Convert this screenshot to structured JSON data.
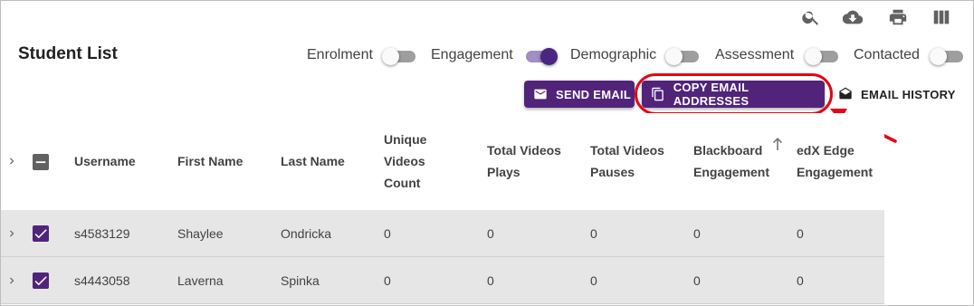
{
  "page": {
    "title": "Student List"
  },
  "toolbar_icons": [
    "search-icon",
    "cloud-download-icon",
    "print-icon",
    "view-column-icon"
  ],
  "toggles": [
    {
      "label": "Enrolment",
      "on": false
    },
    {
      "label": "Engagement",
      "on": true
    },
    {
      "label": "Demographic",
      "on": false
    },
    {
      "label": "Assessment",
      "on": false
    },
    {
      "label": "Contacted",
      "on": false
    }
  ],
  "actions": {
    "send_email": "SEND EMAIL",
    "copy_email_addresses": "COPY EMAIL ADDRESSES",
    "email_history": "EMAIL HISTORY"
  },
  "table": {
    "headers": {
      "username": "Username",
      "first_name": "First Name",
      "last_name": "Last Name",
      "unique_videos_1": "Unique",
      "unique_videos_2": "Videos",
      "unique_videos_3": "Count",
      "total_plays_1": "Total Videos",
      "total_plays_2": "Plays",
      "total_pauses_1": "Total Videos",
      "total_pauses_2": "Pauses",
      "blackboard_1": "Blackboard",
      "blackboard_2": "Engagement",
      "edx_1": "edX Edge",
      "edx_2": "Engagement"
    },
    "rows": [
      {
        "username": "s4583129",
        "first_name": "Shaylee",
        "last_name": "Ondricka",
        "unique_videos": "0",
        "total_plays": "0",
        "total_pauses": "0",
        "blackboard": "0",
        "edx": "0"
      },
      {
        "username": "s4443058",
        "first_name": "Laverna",
        "last_name": "Spinka",
        "unique_videos": "0",
        "total_plays": "0",
        "total_pauses": "0",
        "blackboard": "0",
        "edx": "0"
      }
    ]
  },
  "colors": {
    "primary": "#51247a",
    "highlight": "#e30613"
  }
}
